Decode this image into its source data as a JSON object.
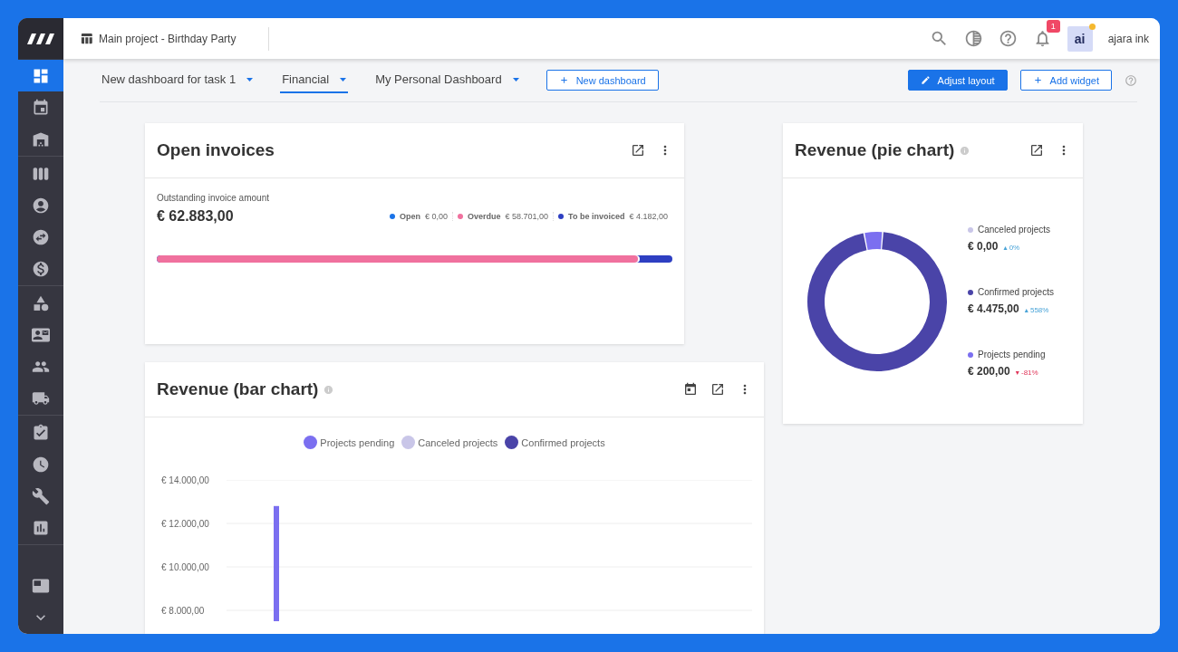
{
  "sidebar": {
    "groups": [
      [
        {
          "kind": "dashboard",
          "selected": true
        },
        {
          "kind": "calendar",
          "selected": false
        },
        {
          "kind": "warehouse",
          "selected": false
        }
      ],
      [
        {
          "kind": "table",
          "selected": false
        },
        {
          "kind": "person",
          "selected": false
        },
        {
          "kind": "swap",
          "selected": false
        },
        {
          "kind": "dollar",
          "selected": false
        }
      ],
      [
        {
          "kind": "shapes",
          "selected": false
        },
        {
          "kind": "contact",
          "selected": false
        },
        {
          "kind": "people",
          "selected": false
        },
        {
          "kind": "truck",
          "selected": false
        }
      ],
      [
        {
          "kind": "clipboard",
          "selected": false
        },
        {
          "kind": "clock",
          "selected": false
        },
        {
          "kind": "wrench",
          "selected": false
        },
        {
          "kind": "chart",
          "selected": false
        }
      ],
      [
        {
          "kind": "screen",
          "selected": false
        },
        {
          "kind": "expand",
          "selected": false
        }
      ]
    ]
  },
  "topbar": {
    "project": "Main project - Birthday Party",
    "notifications": "1",
    "avatar": "ai",
    "user": "ajara ink"
  },
  "dashboard_tabs": [
    {
      "label": "New dashboard for task 1",
      "selected": false
    },
    {
      "label": "Financial",
      "selected": true
    },
    {
      "label": "My Personal Dashboard",
      "selected": false
    }
  ],
  "new_dashboard": "New dashboard",
  "adjust_layout": "Adjust layout",
  "add_widget": "Add widget",
  "open_invoices": {
    "title": "Open invoices",
    "caption": "Outstanding invoice amount",
    "total": "€ 62.883,00",
    "legend": [
      {
        "label": "Open",
        "amount": "€ 0,00",
        "color": "#1a73e8"
      },
      {
        "label": "Overdue",
        "amount": "€ 58.701,00",
        "color": "#f0719e"
      },
      {
        "label": "To be invoiced",
        "amount": "€ 4.182,00",
        "color": "#2e3fc2"
      }
    ],
    "overdue_bar": {
      "level": 0.934
    }
  },
  "revenue_pie": {
    "title": "Revenue (pie chart)",
    "chart_data": {
      "type": "donut",
      "categories": [
        "Canceled projects",
        "Confirmed projects",
        "Projects pending"
      ],
      "values": [
        0,
        95.7,
        4.3
      ],
      "colors": [
        "#c9c6e8",
        "#4a44a8",
        "#7b6ff0"
      ]
    },
    "items": [
      {
        "amount": "€ 0,00",
        "arrow": "▴",
        "change": "0%",
        "kind": "rise"
      },
      {
        "amount": "€ 4.475,00",
        "arrow": "▴",
        "change": "558%",
        "kind": "rise"
      },
      {
        "amount": "€ 200,00",
        "arrow": "▾",
        "change": "-81%",
        "kind": "fall"
      }
    ]
  },
  "revenue_bar": {
    "title": "Revenue (bar chart)",
    "chart_data": {
      "type": "bar",
      "grid": true,
      "ylim": [
        7500,
        14000
      ],
      "yticks": [
        {
          "value": 8000,
          "label": "€ 8.000,00"
        },
        {
          "value": 10000,
          "label": "€ 10.000,00"
        },
        {
          "value": 12000,
          "label": "€ 12.000,00"
        },
        {
          "value": 14000,
          "label": "€ 14.000,00"
        }
      ],
      "series": [
        {
          "name": "Projects pending",
          "color": "#7b6ff0",
          "values": [
            12800
          ]
        },
        {
          "name": "Canceled projects",
          "color": "#c9c6e8",
          "values": [
            null
          ]
        },
        {
          "name": "Confirmed projects",
          "color": "#4a44a8",
          "values": [
            null
          ]
        }
      ]
    }
  }
}
